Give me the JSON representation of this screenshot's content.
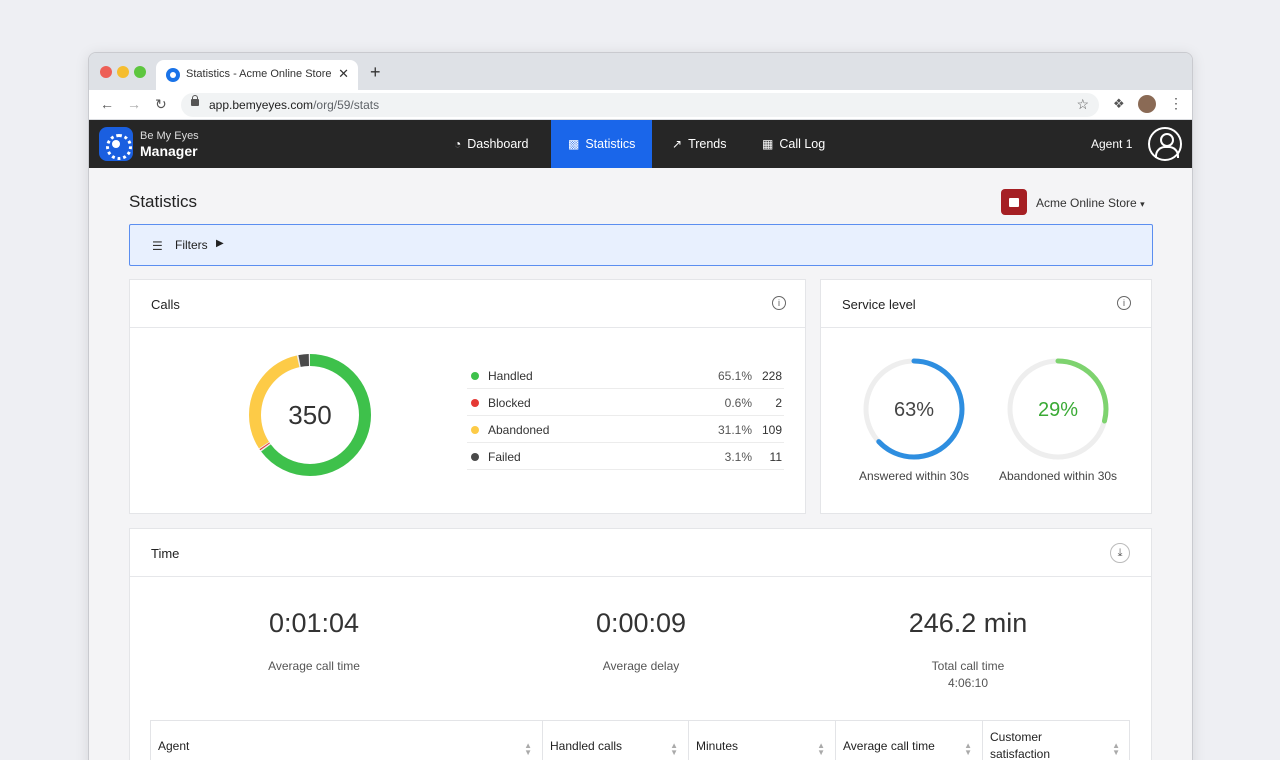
{
  "browser": {
    "tab_title": "Statistics - Acme Online Store",
    "tab_close": "✕",
    "new_tab": "+",
    "url_host": "app.bemyeyes.com",
    "url_path": "/org/59/stats",
    "traffic_lights": [
      "#ed5f57",
      "#f5bd2f",
      "#5dc63f"
    ]
  },
  "app": {
    "brand_line1": "Be My Eyes",
    "brand_line2": "Manager",
    "nav": [
      {
        "label": "Dashboard",
        "icon": "gauge-icon"
      },
      {
        "label": "Statistics",
        "icon": "chart-icon",
        "active": true
      },
      {
        "label": "Trends",
        "icon": "trend-icon"
      },
      {
        "label": "Call Log",
        "icon": "table-icon"
      }
    ],
    "agent_name": "Agent 1"
  },
  "page": {
    "title": "Statistics",
    "store_name": "Acme Online Store",
    "filters_label": "Filters"
  },
  "calls": {
    "title": "Calls",
    "total": "350",
    "rows": [
      {
        "label": "Handled",
        "percent": "65.1%",
        "count": "228",
        "color": "#3ec14b"
      },
      {
        "label": "Blocked",
        "percent": "0.6%",
        "count": "2",
        "color": "#e53935"
      },
      {
        "label": "Abandoned",
        "percent": "31.1%",
        "count": "109",
        "color": "#fdcb47"
      },
      {
        "label": "Failed",
        "percent": "3.1%",
        "count": "11",
        "color": "#4a4a4a"
      }
    ]
  },
  "service_level": {
    "title": "Service level",
    "answered": {
      "value": "63%",
      "fraction": 0.63,
      "label": "Answered within 30s",
      "color": "#2e8ee0"
    },
    "abandoned": {
      "value": "29%",
      "fraction": 0.29,
      "label": "Abandoned within 30s",
      "color": "#3aaa35"
    }
  },
  "time": {
    "title": "Time",
    "avg_call_time": {
      "value": "0:01:04",
      "label": "Average call time"
    },
    "avg_delay": {
      "value": "0:00:09",
      "label": "Average delay"
    },
    "total_call_time": {
      "value": "246.2 min",
      "label": "Total call time",
      "sub": "4:06:10"
    },
    "table_headers": [
      "Agent",
      "Handled calls",
      "Minutes",
      "Average call time",
      "Customer satisfaction"
    ]
  }
}
